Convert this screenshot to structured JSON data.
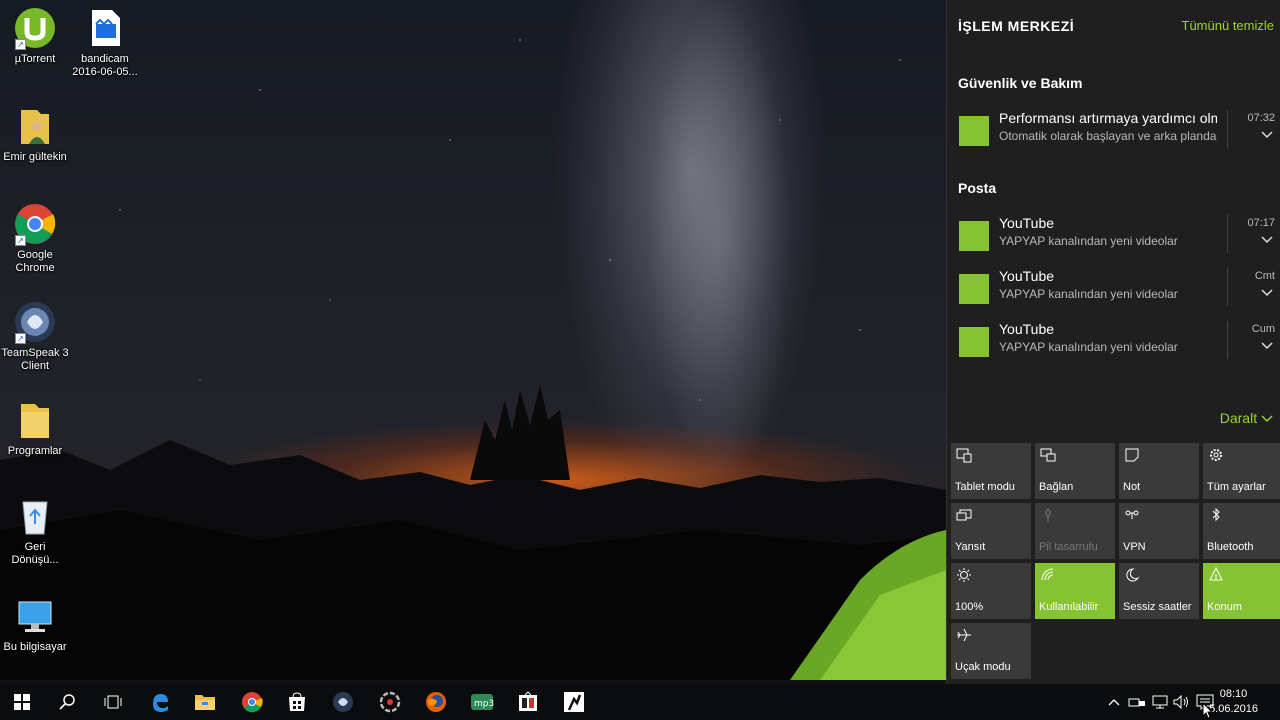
{
  "desktop": {
    "icons": [
      {
        "label": "µTorrent",
        "icon": "utorrent-icon"
      },
      {
        "label": "bandicam 2016-06-05...",
        "icon": "video-file-icon"
      },
      {
        "label": "Emir gültekin",
        "icon": "user-folder-icon"
      },
      {
        "label": "Google Chrome",
        "icon": "chrome-icon"
      },
      {
        "label": "TeamSpeak 3 Client",
        "icon": "teamspeak-icon"
      },
      {
        "label": "Programlar",
        "icon": "folder-icon"
      },
      {
        "label": "Geri Dönüşü...",
        "icon": "recycle-bin-icon"
      },
      {
        "label": "Bu bilgisayar",
        "icon": "computer-icon"
      }
    ]
  },
  "action_center": {
    "title": "İŞLEM MERKEZİ",
    "clear_all": "Tümünü temizle",
    "groups": [
      {
        "name": "Güvenlik ve Bakım",
        "notifications": [
          {
            "title": "Performansı artırmaya yardımcı olm",
            "body": "Otomatik olarak başlayan ve arka planda",
            "time": "07:32"
          }
        ]
      },
      {
        "name": "Posta",
        "notifications": [
          {
            "title": "YouTube",
            "body": "YAPYAP kanalından yeni videolar",
            "time": "07:17"
          },
          {
            "title": "YouTube",
            "body": "YAPYAP kanalından yeni videolar",
            "time": "Cmt"
          },
          {
            "title": "YouTube",
            "body": "YAPYAP kanalından yeni videolar",
            "time": "Cum"
          }
        ]
      }
    ],
    "collapse": "Daralt",
    "quick_actions": [
      {
        "label": "Tablet modu",
        "icon": "tablet-mode-icon",
        "state": "off"
      },
      {
        "label": "Bağlan",
        "icon": "connect-icon",
        "state": "off"
      },
      {
        "label": "Not",
        "icon": "note-icon",
        "state": "off"
      },
      {
        "label": "Tüm ayarlar",
        "icon": "gear-icon",
        "state": "off"
      },
      {
        "label": "Yansıt",
        "icon": "project-icon",
        "state": "off"
      },
      {
        "label": "Pil tasarrufu",
        "icon": "battery-saver-icon",
        "state": "disabled"
      },
      {
        "label": "VPN",
        "icon": "vpn-icon",
        "state": "off"
      },
      {
        "label": "Bluetooth",
        "icon": "bluetooth-icon",
        "state": "off"
      },
      {
        "label": "100%",
        "icon": "brightness-icon",
        "state": "off"
      },
      {
        "label": "Kullanılabilir",
        "icon": "wifi-icon",
        "state": "on"
      },
      {
        "label": "Sessiz saatler",
        "icon": "moon-icon",
        "state": "off"
      },
      {
        "label": "Konum",
        "icon": "location-icon",
        "state": "on"
      },
      {
        "label": "Uçak modu",
        "icon": "airplane-icon",
        "state": "off"
      }
    ]
  },
  "taskbar": {
    "pinned": [
      "start-icon",
      "search-icon",
      "task-view-icon",
      "edge-icon",
      "file-explorer-icon",
      "chrome-icon",
      "store-icon",
      "teamspeak-icon",
      "app-icon",
      "firefox-icon",
      "mp3-icon",
      "media-icon",
      "steam-icon"
    ],
    "tray_icons": [
      "chevron-up-icon",
      "device-icon",
      "network-icon",
      "volume-icon",
      "action-center-icon"
    ],
    "time": "08:10",
    "date": "5.06.2016"
  },
  "colors": {
    "accent": "#86c232",
    "link": "#9fd52b",
    "panel_bg": "#1f1f1f",
    "tile_off": "#3a3a3a"
  }
}
